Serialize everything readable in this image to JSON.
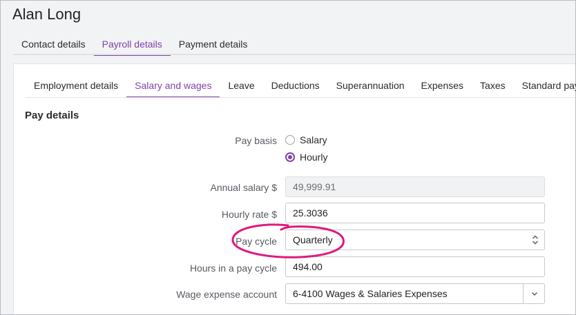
{
  "header": {
    "title": "Alan Long"
  },
  "top_tabs": [
    {
      "label": "Contact details",
      "active": false
    },
    {
      "label": "Payroll details",
      "active": true
    },
    {
      "label": "Payment details",
      "active": false
    }
  ],
  "sub_tabs": [
    {
      "label": "Employment details",
      "active": false
    },
    {
      "label": "Salary and wages",
      "active": true
    },
    {
      "label": "Leave",
      "active": false
    },
    {
      "label": "Deductions",
      "active": false
    },
    {
      "label": "Superannuation",
      "active": false
    },
    {
      "label": "Expenses",
      "active": false
    },
    {
      "label": "Taxes",
      "active": false
    },
    {
      "label": "Standard pay",
      "active": false
    }
  ],
  "section": {
    "title": "Pay details"
  },
  "form": {
    "pay_basis": {
      "label": "Pay basis",
      "options": [
        "Salary",
        "Hourly"
      ],
      "selected": "Hourly"
    },
    "annual_salary": {
      "label": "Annual salary $",
      "value": "49,999.91"
    },
    "hourly_rate": {
      "label": "Hourly rate $",
      "value": "25.3036"
    },
    "pay_cycle": {
      "label": "Pay cycle",
      "value": "Quarterly"
    },
    "hours_in_cycle": {
      "label": "Hours in a pay cycle",
      "value": "494.00"
    },
    "wage_expense_account": {
      "label": "Wage expense account",
      "value": "6-4100 Wages & Salaries Expenses"
    }
  },
  "colors": {
    "accent": "#8241aa",
    "annotation": "#e0197d"
  },
  "icons": {
    "select_arrows": "up-down-arrows-icon",
    "dropdown": "chevron-down-icon",
    "radio": "radio-icon"
  }
}
